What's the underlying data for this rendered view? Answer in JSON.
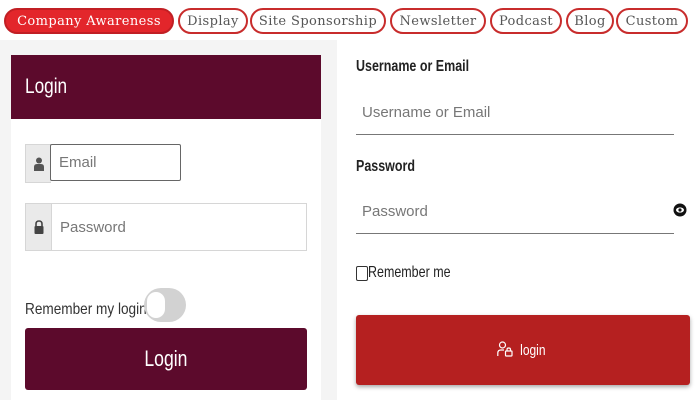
{
  "tabs": [
    {
      "label": "Company Awareness",
      "active": true
    },
    {
      "label": "Display",
      "active": false
    },
    {
      "label": "Site Sponsorship",
      "active": false
    },
    {
      "label": "Newsletter",
      "active": false
    },
    {
      "label": "Podcast",
      "active": false
    },
    {
      "label": "Blog",
      "active": false
    },
    {
      "label": "Custom",
      "active": false
    }
  ],
  "left_login": {
    "title": "Login",
    "email_placeholder": "Email",
    "password_placeholder": "Password",
    "remember_label": "Remember my login",
    "remember_on": false,
    "button_label": "Login",
    "user_icon": "user-icon",
    "lock_icon": "lock-icon"
  },
  "right_login": {
    "username_label": "Username or Email",
    "username_placeholder": "Username or Email",
    "password_label": "Password",
    "password_placeholder": "Password",
    "remember_label": "Remember me",
    "remember_checked": false,
    "button_label": "login",
    "button_icon": "user-lock-icon",
    "eye_icon": "eye-icon"
  },
  "colors": {
    "tab_border": "#c82c2c",
    "tab_active_bg": "#e3262b",
    "left_brand": "#5c0a2c",
    "right_button": "#b52020"
  }
}
